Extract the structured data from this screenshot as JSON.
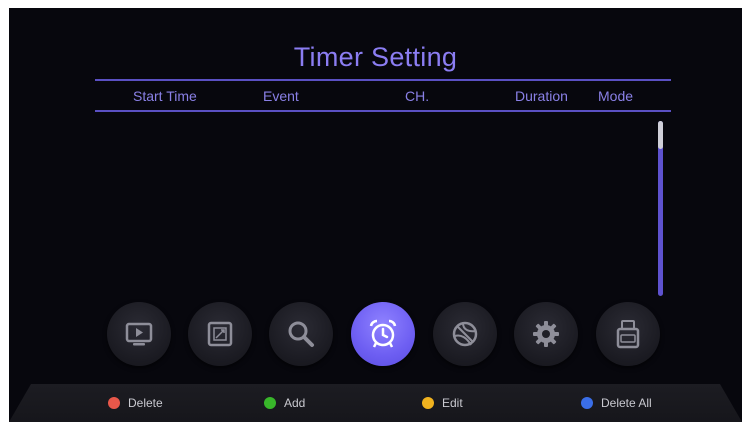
{
  "header": {
    "title": "Timer Setting"
  },
  "columns": [
    "Start Time",
    "Event",
    "CH.",
    "Duration",
    "Mode"
  ],
  "rows": [],
  "menu": [
    {
      "name": "media",
      "icon": "play-screen-icon",
      "active": false
    },
    {
      "name": "picture",
      "icon": "picture-frame-icon",
      "active": false
    },
    {
      "name": "search",
      "icon": "magnifier-icon",
      "active": false
    },
    {
      "name": "timer",
      "icon": "alarm-clock-icon",
      "active": true
    },
    {
      "name": "network",
      "icon": "globe-icon",
      "active": false
    },
    {
      "name": "settings",
      "icon": "gear-icon",
      "active": false
    },
    {
      "name": "usb",
      "icon": "usb-icon",
      "active": false
    }
  ],
  "footer": {
    "keys": [
      {
        "label": "Delete",
        "color": "#e8574a"
      },
      {
        "label": "Add",
        "color": "#38b62a"
      },
      {
        "label": "Edit",
        "color": "#f0b21f"
      },
      {
        "label": "Delete All",
        "color": "#3a6ee8"
      }
    ]
  },
  "colors": {
    "accent": "#8b7df2",
    "rule": "#5a50c2",
    "background": "#07070d"
  }
}
